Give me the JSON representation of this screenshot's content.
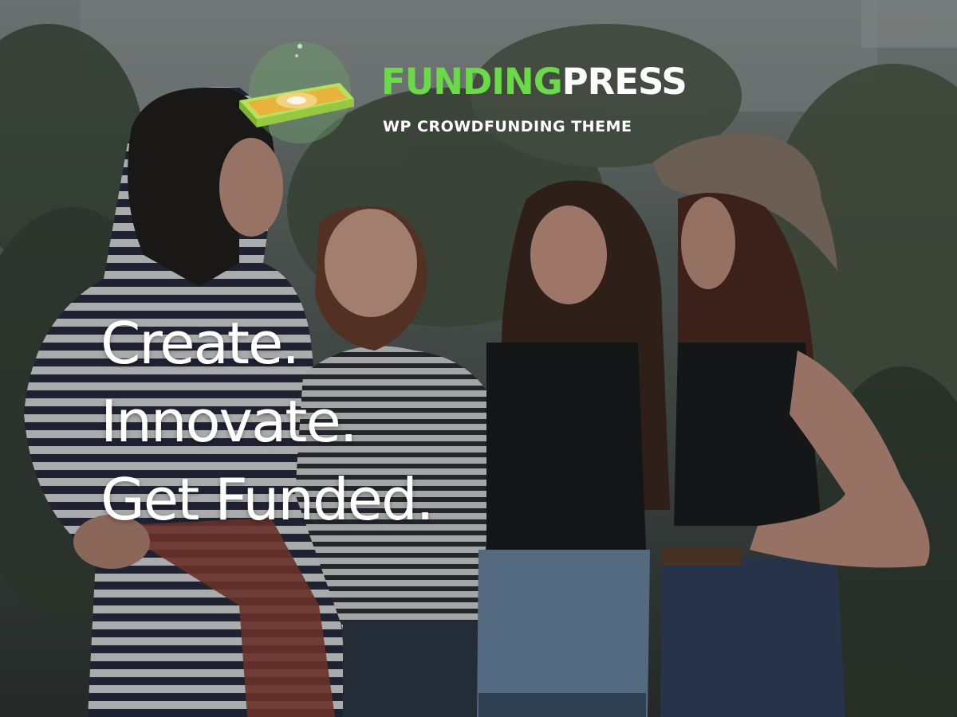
{
  "brand": {
    "name_part1": "FUNDING",
    "name_part2": "PRESS",
    "tagline": "WP CROWDFUNDING THEME",
    "accent_color": "#6cd94a",
    "logo_icon": "cash-stack-icon"
  },
  "hero": {
    "lines": [
      "Create.",
      "Innovate.",
      "Get Funded."
    ],
    "background": "group-of-four-smiling-women-photo"
  }
}
